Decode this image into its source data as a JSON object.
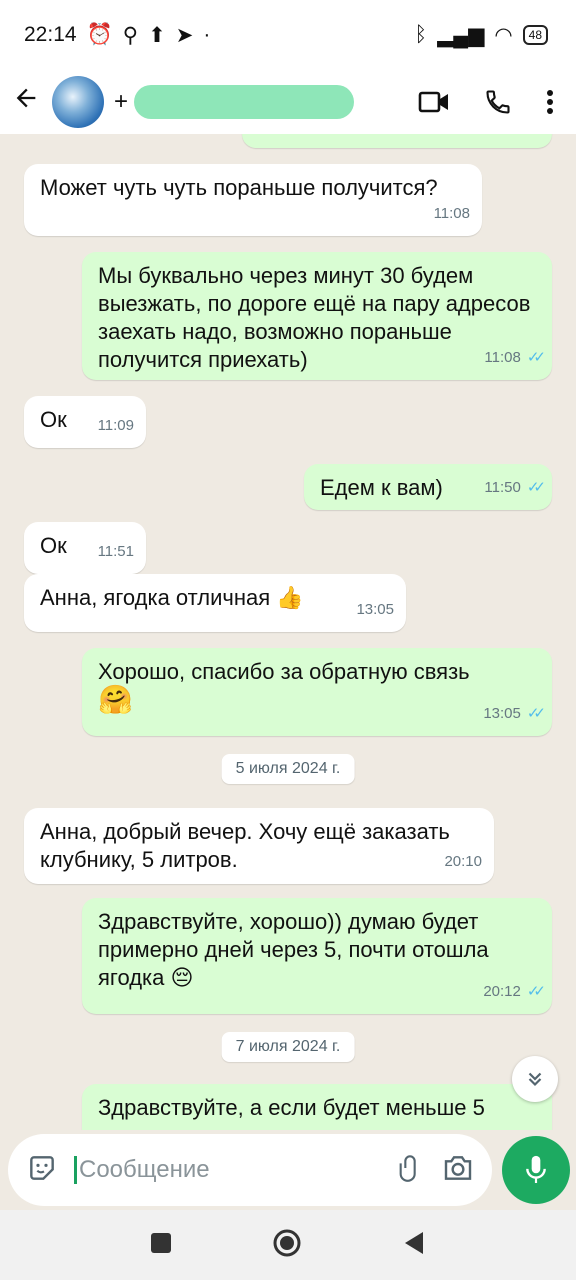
{
  "status": {
    "time": "22:14",
    "battery": "48"
  },
  "header": {
    "contact_prefix": "+"
  },
  "messages": [
    {
      "dir": "in",
      "text": "Может чуть чуть пораньше получится?",
      "time": "11:08"
    },
    {
      "dir": "out",
      "text": "Мы буквально через минут 30 будем выезжать, по дороге ещё на пару адресов заехать надо, возможно пораньше получится приехать)",
      "time": "11:08"
    },
    {
      "dir": "in",
      "text": "Ок",
      "time": "11:09"
    },
    {
      "dir": "out",
      "text": "Едем к вам)",
      "time": "11:50"
    },
    {
      "dir": "in",
      "text": "Ок",
      "time": "11:51"
    },
    {
      "dir": "in",
      "text": "Анна, ягодка отличная 👍",
      "time": "13:05"
    },
    {
      "dir": "out",
      "text": "Хорошо, спасибо за обратную связь",
      "emoji": "🤗",
      "time": "13:05"
    },
    {
      "dir": "in",
      "text": "Анна, добрый вечер. Хочу ещё заказать клубнику, 5 литров.",
      "time": "20:10"
    },
    {
      "dir": "out",
      "text": "Здравствуйте, хорошо)) думаю будет примерно дней через 5, почти отошла ягодка 😔",
      "time": "20:12"
    },
    {
      "dir": "out",
      "text": "Здравствуйте, а если будет меньше 5"
    }
  ],
  "dates": [
    "5 июля 2024 г.",
    "7 июля 2024 г."
  ],
  "composer": {
    "placeholder": "Сообщение"
  },
  "icons": {
    "back": "arrow-left-icon",
    "video": "video-camera-icon",
    "call": "phone-icon",
    "menu": "more-vertical-icon",
    "emoji": "sticker-icon",
    "attach": "paperclip-icon",
    "camera": "camera-icon",
    "mic": "microphone-icon",
    "read": "double-check-icon"
  },
  "colors": {
    "incoming": "#ffffff",
    "outgoing": "#d9fdd3",
    "accent": "#1daa61",
    "read_ticks": "#53bdeb"
  }
}
